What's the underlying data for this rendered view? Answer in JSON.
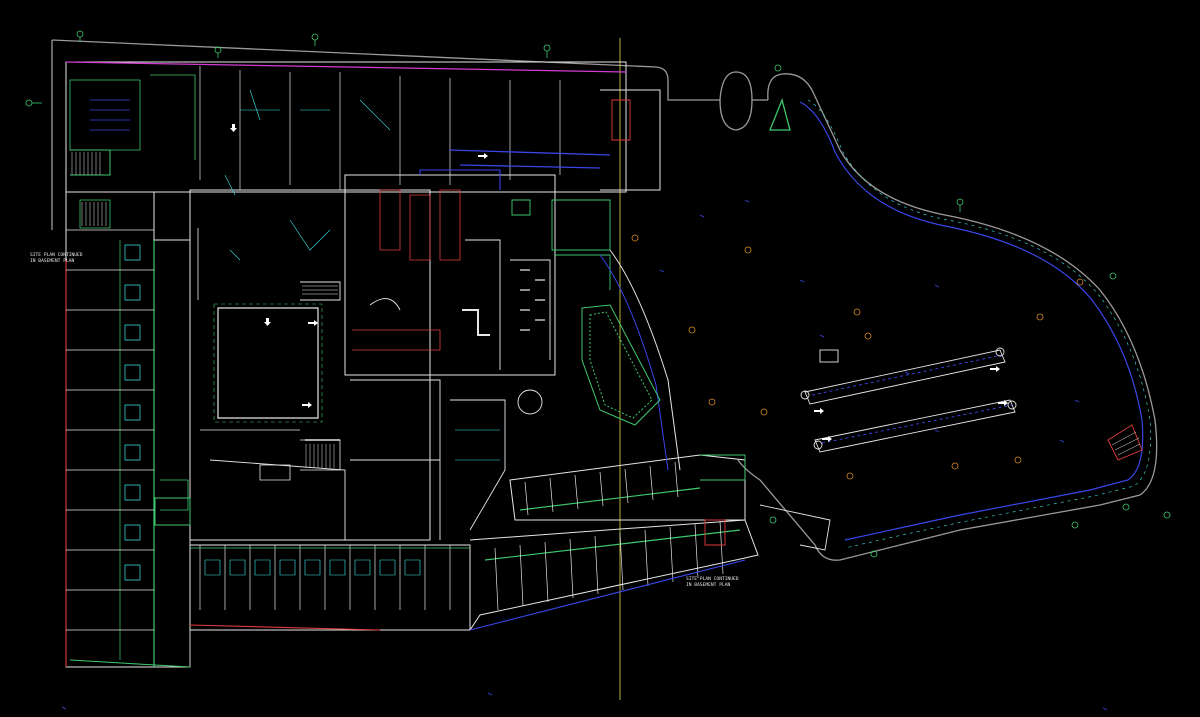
{
  "drawing": {
    "annotations": [
      {
        "id": "west",
        "lines": [
          "SITE PLAN CONTINUED",
          "IN BASEMENT PLAN"
        ]
      },
      {
        "id": "south",
        "lines": [
          "SITE PLAN CONTINUED",
          "IN BASEMENT PLAN"
        ]
      }
    ]
  },
  "colors": {
    "background": "#000000",
    "walls": "#e6e6e6",
    "structure": "#3ec96e",
    "cyan": "#3fe6e6",
    "magenta": "#d23cd2",
    "blue": "#3a46e8",
    "red": "#e23a3a",
    "yellow": "#e0dd4a",
    "orange": "#d88a2a",
    "site_outline": "#9a9a9a"
  },
  "icons": [
    "north-arrow-icon",
    "column-grid-bubble-icon",
    "tree-symbol-icon",
    "stair-icon"
  ]
}
